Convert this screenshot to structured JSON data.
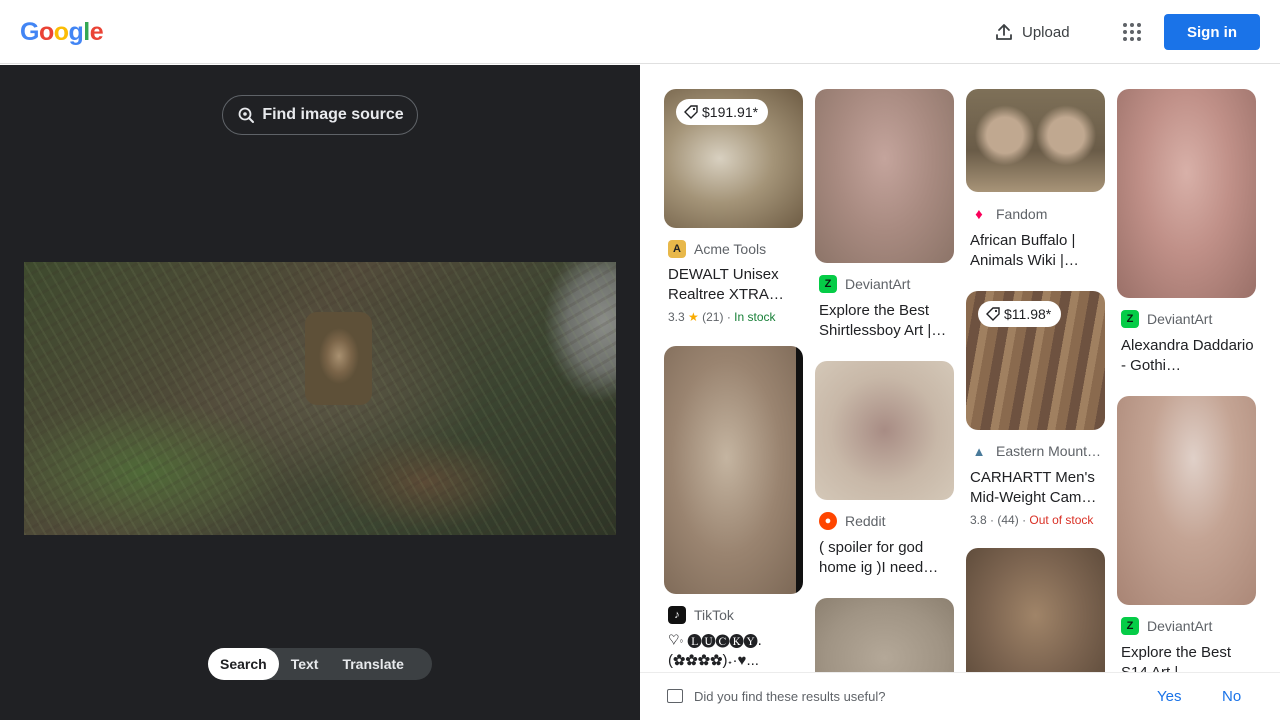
{
  "header": {
    "logo": "Google",
    "upload_label": "Upload",
    "signin_label": "Sign in"
  },
  "left_panel": {
    "find_image_source_label": "Find image source",
    "modes": [
      {
        "label": "Search",
        "active": true
      },
      {
        "label": "Text",
        "active": false
      },
      {
        "label": "Translate",
        "active": false
      }
    ]
  },
  "results": [
    {
      "price": "$191.91*",
      "source": "Acme Tools",
      "title": "DEWALT Unisex Realtree XTRA…",
      "rating": "3.3",
      "reviews": "(21)",
      "stock": "In stock",
      "stock_status": "in"
    },
    {
      "source": "TikTok",
      "title": "♡ං 🅛🅤🅒🅚🅨. (✿✿✿✿)˖·♥..."
    },
    {
      "source": "DeviantArt",
      "title": "Explore the Best Shirtlessboy Art |…"
    },
    {
      "source": "Reddit",
      "title": "( spoiler for god home ig )I need…"
    },
    {
      "source": "Fandom",
      "title": "African Buffalo | Animals Wiki |…"
    },
    {
      "price": "$11.98*",
      "source": "Eastern Mount…",
      "title": "CARHARTT Men's Mid-Weight Cam…",
      "rating": "3.8",
      "reviews": "(44)",
      "stock": "Out of stock",
      "stock_status": "out"
    },
    {
      "source": "DeviantArt",
      "title": "Alexandra Daddario - Gothi…"
    },
    {
      "source": "DeviantArt",
      "title": "Explore the Best S14 Art |…"
    }
  ],
  "feedback": {
    "question": "Did you find these results useful?",
    "yes_label": "Yes",
    "no_label": "No"
  },
  "colors": {
    "accent": "#1a73e8",
    "dark_bg": "#202124",
    "in_stock": "#188038",
    "out_of_stock": "#d93025"
  }
}
